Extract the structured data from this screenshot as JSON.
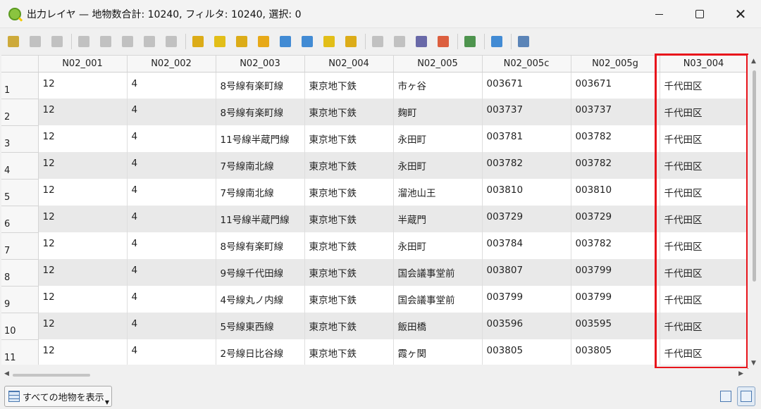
{
  "window": {
    "title": "出力レイヤ — 地物数合計: 10240, フィルタ: 10240, 選択: 0"
  },
  "toolbar": {
    "icons": [
      {
        "name": "pencil-edit-icon",
        "color": "#c9a227"
      },
      {
        "name": "multi-edit-icon",
        "color": "#9a9a9a"
      },
      {
        "name": "save-edits-icon",
        "color": "#9a9a9a"
      },
      {
        "name": "add-feature-icon",
        "color": "#9a9a9a"
      },
      {
        "name": "delete-feature-icon",
        "color": "#9a9a9a"
      },
      {
        "name": "cut-icon",
        "color": "#9a9a9a"
      },
      {
        "name": "copy-icon",
        "color": "#9a9a9a"
      },
      {
        "name": "paste-icon",
        "color": "#9a9a9a"
      },
      {
        "name": "expression-select-icon",
        "color": "#d9a400"
      },
      {
        "name": "select-all-icon",
        "color": "#e0b800"
      },
      {
        "name": "invert-selection-icon",
        "color": "#d9a400"
      },
      {
        "name": "deselect-icon",
        "color": "#e6a100"
      },
      {
        "name": "filter-icon",
        "color": "#2f7fd0"
      },
      {
        "name": "move-selection-top-icon",
        "color": "#2f7fd0"
      },
      {
        "name": "pan-to-selection-icon",
        "color": "#e0b800"
      },
      {
        "name": "zoom-to-selection-icon",
        "color": "#d9a400"
      },
      {
        "name": "new-field-icon",
        "color": "#9a9a9a"
      },
      {
        "name": "delete-field-icon",
        "color": "#9a9a9a"
      },
      {
        "name": "field-calculator-icon",
        "color": "#5a5aa0"
      },
      {
        "name": "conditional-format-icon",
        "color": "#d94f2b"
      },
      {
        "name": "dock-toggle-icon",
        "color": "#3c8a3c"
      },
      {
        "name": "actions-icon",
        "color": "#2f7fd0"
      },
      {
        "name": "organize-columns-icon",
        "color": "#4a78b0"
      }
    ]
  },
  "table": {
    "columns": [
      "N02_001",
      "N02_002",
      "N02_003",
      "N02_004",
      "N02_005",
      "N02_005c",
      "N02_005g",
      "N03_004"
    ],
    "rows": [
      {
        "num": "1",
        "cells": [
          "12",
          "4",
          "8号線有楽町線",
          "東京地下鉄",
          "市ヶ谷",
          "003671",
          "003671",
          "千代田区"
        ]
      },
      {
        "num": "2",
        "cells": [
          "12",
          "4",
          "8号線有楽町線",
          "東京地下鉄",
          "麹町",
          "003737",
          "003737",
          "千代田区"
        ]
      },
      {
        "num": "3",
        "cells": [
          "12",
          "4",
          "11号線半蔵門線",
          "東京地下鉄",
          "永田町",
          "003781",
          "003782",
          "千代田区"
        ]
      },
      {
        "num": "4",
        "cells": [
          "12",
          "4",
          "7号線南北線",
          "東京地下鉄",
          "永田町",
          "003782",
          "003782",
          "千代田区"
        ]
      },
      {
        "num": "5",
        "cells": [
          "12",
          "4",
          "7号線南北線",
          "東京地下鉄",
          "溜池山王",
          "003810",
          "003810",
          "千代田区"
        ]
      },
      {
        "num": "6",
        "cells": [
          "12",
          "4",
          "11号線半蔵門線",
          "東京地下鉄",
          "半蔵門",
          "003729",
          "003729",
          "千代田区"
        ]
      },
      {
        "num": "7",
        "cells": [
          "12",
          "4",
          "8号線有楽町線",
          "東京地下鉄",
          "永田町",
          "003784",
          "003782",
          "千代田区"
        ]
      },
      {
        "num": "8",
        "cells": [
          "12",
          "4",
          "9号線千代田線",
          "東京地下鉄",
          "国会議事堂前",
          "003807",
          "003799",
          "千代田区"
        ]
      },
      {
        "num": "9",
        "cells": [
          "12",
          "4",
          "4号線丸ノ内線",
          "東京地下鉄",
          "国会議事堂前",
          "003799",
          "003799",
          "千代田区"
        ]
      },
      {
        "num": "10",
        "cells": [
          "12",
          "4",
          "5号線東西線",
          "東京地下鉄",
          "飯田橋",
          "003596",
          "003595",
          "千代田区"
        ]
      },
      {
        "num": "11",
        "cells": [
          "12",
          "4",
          "2号線日比谷線",
          "東京地下鉄",
          "霞ヶ関",
          "003805",
          "003805",
          "千代田区"
        ]
      }
    ],
    "highlight_color": "#e8141b"
  },
  "bottombar": {
    "show_all_label": "すべての地物を表示"
  }
}
